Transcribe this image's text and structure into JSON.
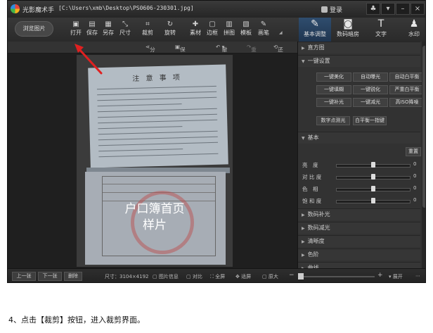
{
  "app": {
    "name": "光影魔术手",
    "path": "[C:\\Users\\xmb\\Desktop\\PS0606-230301.jpg]",
    "login": "登录"
  },
  "toolbar": {
    "browse": "浏览图片",
    "tools": [
      {
        "label": "打开",
        "icon": "open-icon",
        "glyph": "▣"
      },
      {
        "label": "保存",
        "icon": "save-icon",
        "glyph": "▤"
      },
      {
        "label": "另存",
        "icon": "save-as-icon",
        "glyph": "▦"
      },
      {
        "label": "尺寸",
        "icon": "resize-icon",
        "glyph": "⤡"
      },
      {
        "label": "裁剪",
        "icon": "crop-icon",
        "glyph": "⌗"
      },
      {
        "label": "旋转",
        "icon": "rotate-icon",
        "glyph": "↻"
      },
      {
        "label": "素材",
        "icon": "material-icon",
        "glyph": "✚"
      },
      {
        "label": "边框",
        "icon": "border-icon",
        "glyph": "▢"
      },
      {
        "label": "拼图",
        "icon": "puzzle-icon",
        "glyph": "▥"
      },
      {
        "label": "模板",
        "icon": "template-icon",
        "glyph": "▧"
      },
      {
        "label": "画笔",
        "icon": "brush-icon",
        "glyph": "✎"
      }
    ],
    "right_tabs": [
      {
        "label": "基本调整",
        "icon": "adjust-icon",
        "glyph": "✎"
      },
      {
        "label": "数码暗房",
        "icon": "camera-icon",
        "glyph": "◙"
      },
      {
        "label": "文字",
        "icon": "text-icon",
        "glyph": "T"
      },
      {
        "label": "水印",
        "icon": "watermark-icon",
        "glyph": "♟"
      }
    ]
  },
  "subbar": {
    "share": "分享",
    "save_action": "保存动作",
    "undo": "撤销",
    "redo": "重做",
    "restore": "还原"
  },
  "image": {
    "doc_title": "注 意 事 项",
    "watermark_line1": "户口簿首页",
    "watermark_line2": "样片"
  },
  "panel": {
    "histogram": "直方图",
    "one_click": "一键设置",
    "buttons": [
      "一键美化",
      "自动曝光",
      "自动白平衡",
      "一键填糊",
      "一键锐化",
      "严重白平衡",
      "一键补光",
      "一键减光",
      "高ISO降噪"
    ],
    "btn_digital": "数字点测光",
    "btn_wb": "白平衡一指键",
    "basic": "基本",
    "reset": "重置",
    "sliders": [
      {
        "label": "亮　度",
        "value": "0",
        "level": 0.5
      },
      {
        "label": "对 比 度",
        "value": "0",
        "level": 0.5
      },
      {
        "label": "色　相",
        "value": "0",
        "level": 0.5
      },
      {
        "label": "饱 和 度",
        "value": "0",
        "level": 0.5
      }
    ],
    "sections": [
      "数码补光",
      "数码减光",
      "清晰度",
      "色阶",
      "曲线"
    ]
  },
  "bottombar": {
    "prev": "上一张",
    "next": "下一张",
    "delete": "删除",
    "size": "尺寸：3104×4192",
    "info": "图片信息",
    "compare": "对比",
    "fullscreen": "全屏",
    "fit": "适屏",
    "original": "原大",
    "expand": "展开"
  },
  "caption": "4、点击【裁剪】按钮，进入裁剪界面。"
}
